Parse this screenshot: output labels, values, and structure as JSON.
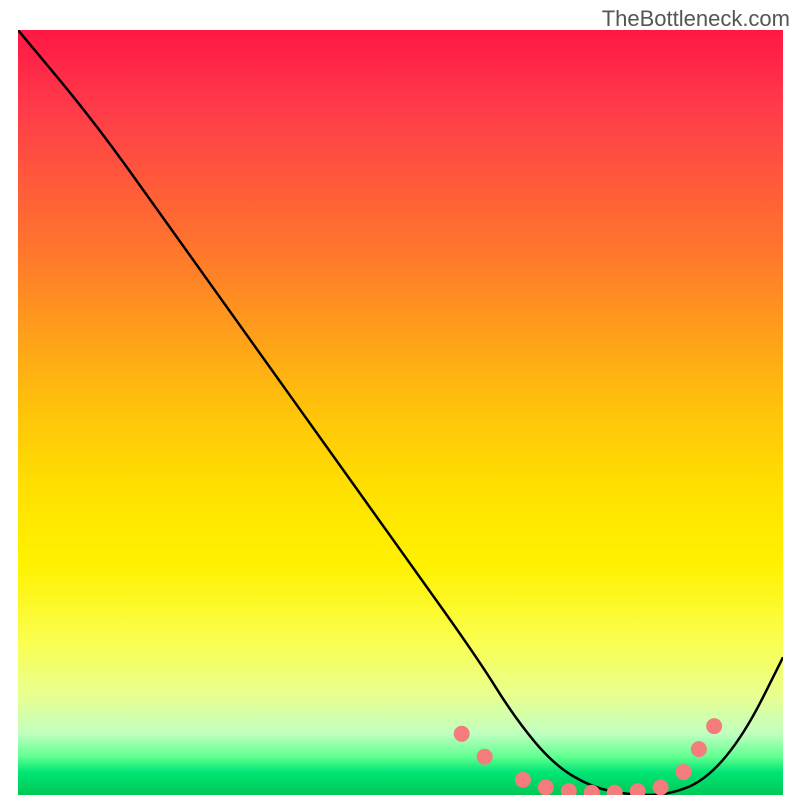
{
  "watermark": "TheBottleneck.com",
  "chart_data": {
    "type": "line",
    "title": "",
    "xlabel": "",
    "ylabel": "",
    "xlim": [
      0,
      100
    ],
    "ylim": [
      0,
      100
    ],
    "series": [
      {
        "name": "bottleneck-curve",
        "x": [
          0,
          10,
          20,
          30,
          40,
          50,
          60,
          65,
          70,
          75,
          80,
          85,
          90,
          95,
          100
        ],
        "y": [
          100,
          88,
          74,
          60,
          46,
          32,
          18,
          10,
          4,
          1,
          0,
          0,
          2,
          8,
          18
        ]
      }
    ],
    "markers": {
      "name": "highlight-points",
      "color": "#f47c7c",
      "x": [
        58,
        61,
        66,
        69,
        72,
        75,
        78,
        81,
        84,
        87,
        89,
        91
      ],
      "y": [
        8,
        5,
        2,
        1,
        0.5,
        0.3,
        0.3,
        0.5,
        1,
        3,
        6,
        9
      ]
    },
    "gradient_stops": [
      {
        "pos": 0,
        "color": "#ff1744"
      },
      {
        "pos": 50,
        "color": "#ffc40a"
      },
      {
        "pos": 80,
        "color": "#faff50"
      },
      {
        "pos": 100,
        "color": "#00c853"
      }
    ]
  }
}
